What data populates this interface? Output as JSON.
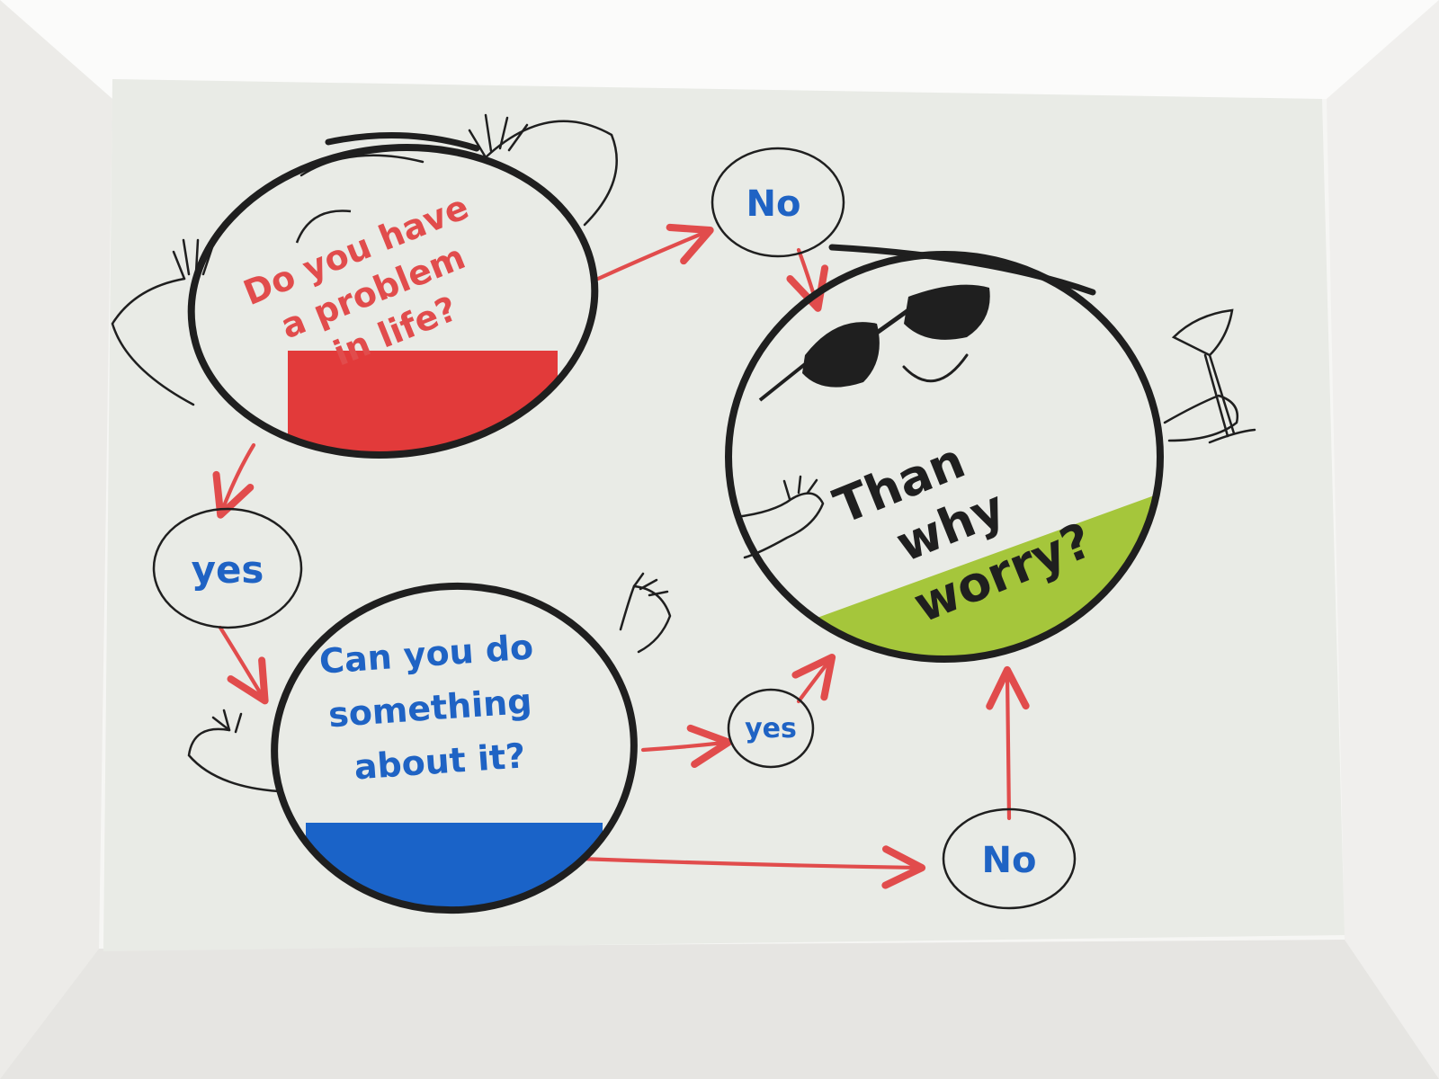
{
  "colors": {
    "frame": "#f6f6f4",
    "paper": "#e9ebe6",
    "ink": "#1f1f1f",
    "red": "#e14c4c",
    "blue": "#1f63c4",
    "green": "#9cbf33",
    "fill_red": "#e23a3a",
    "fill_blue": "#1a63c8",
    "fill_green": "#a5c63b"
  },
  "nodes": {
    "problem": {
      "lines": [
        "Do you have",
        "a problem",
        "in life?"
      ]
    },
    "can_do": {
      "lines": [
        "Can you do",
        "something",
        "about it?"
      ]
    },
    "why_worry": {
      "lines": [
        "Than",
        "why",
        "worry?"
      ]
    }
  },
  "answers": {
    "no_top": "No",
    "yes_left": "yes",
    "yes_mid": "yes",
    "no_bottom": "No"
  }
}
